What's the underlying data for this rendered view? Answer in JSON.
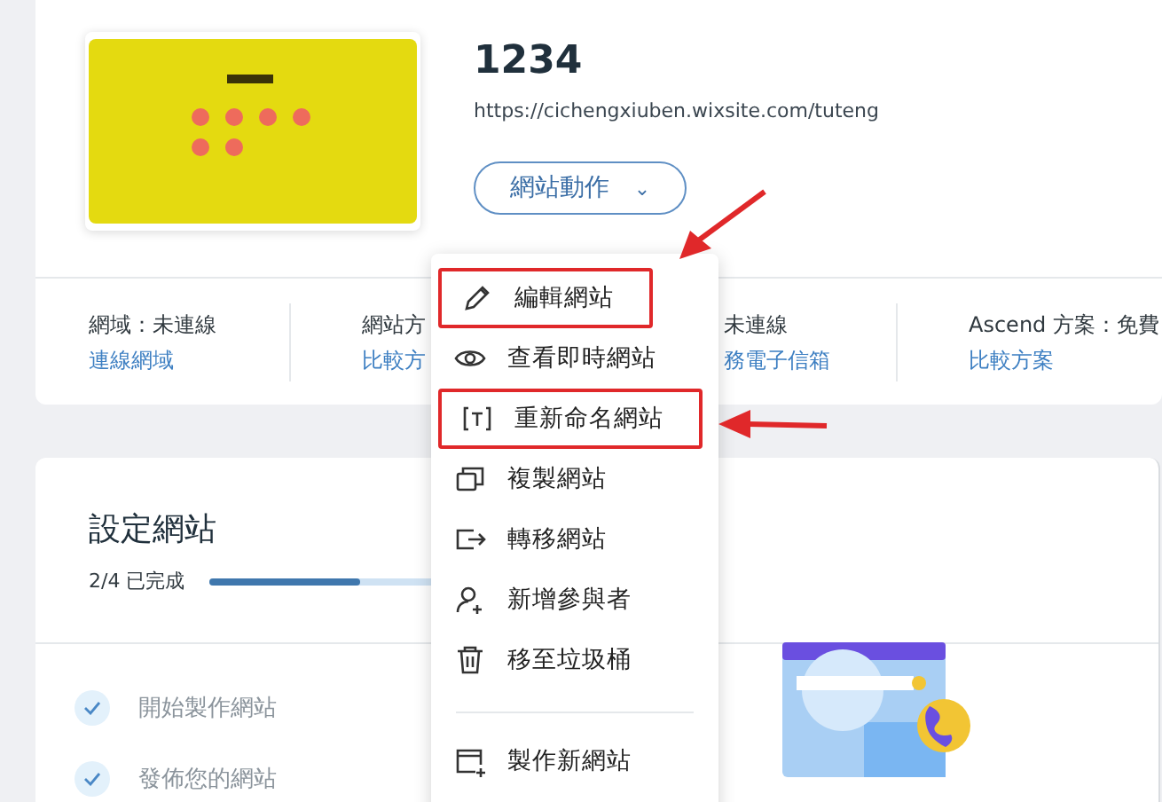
{
  "site": {
    "title": "1234",
    "url": "https://cichengxiuben.wixsite.com/tuteng",
    "actions_button": {
      "label": "網站動作",
      "caret": "⌄"
    }
  },
  "info": [
    {
      "label": "網域：未連線",
      "link": "連線網域"
    },
    {
      "label": "網站方",
      "link": "比較方"
    },
    {
      "label": "未連線",
      "link": "務電子信箱"
    },
    {
      "label": "Ascend 方案：免費",
      "link": "比較方案"
    }
  ],
  "menu": {
    "items": [
      {
        "kind": "edit",
        "label": "編輯網站",
        "annotated": true
      },
      {
        "kind": "view",
        "label": "查看即時網站",
        "annotated": false
      },
      {
        "kind": "rename",
        "label": "重新命名網站",
        "annotated": true
      },
      {
        "kind": "duplicate",
        "label": "複製網站",
        "annotated": false
      },
      {
        "kind": "transfer",
        "label": "轉移網站",
        "annotated": false
      },
      {
        "kind": "contributor",
        "label": "新增參與者",
        "annotated": false
      },
      {
        "kind": "trash",
        "label": "移至垃圾桶",
        "annotated": false
      },
      {
        "kind": "divider"
      },
      {
        "kind": "create",
        "label": "製作新網站",
        "annotated": false
      }
    ]
  },
  "setup": {
    "title": "設定網站",
    "progress_text": "2/4 已完成",
    "level": 0.5,
    "steps": [
      {
        "label": "開始製作網站",
        "checked": true
      },
      {
        "label": "發佈您的網站",
        "checked": true
      }
    ]
  }
}
